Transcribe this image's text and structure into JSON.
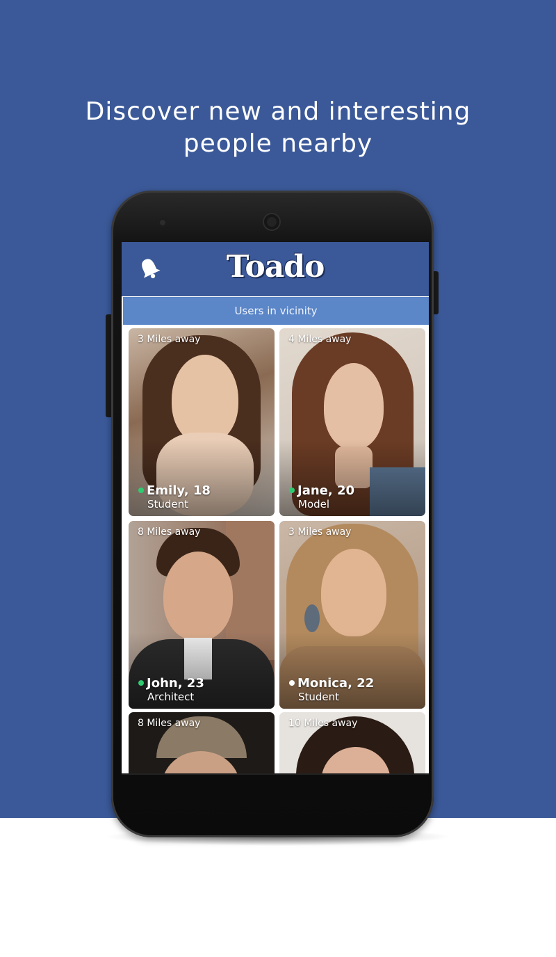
{
  "headline": {
    "line1": "Discover new and interesting",
    "line2": "people nearby"
  },
  "app": {
    "brand": "Toado",
    "subtitle": "Users in vicinity",
    "bell_icon": "bell-icon"
  },
  "colors": {
    "background_blue": "#3b5998",
    "appbar": "#3b5998",
    "subbar": "#5b86c8",
    "online_dot": "#2ecc71",
    "offline_dot": "#ffffff"
  },
  "cards": [
    {
      "distance": "3 Miles away",
      "name": "Emily, 18",
      "job": "Student",
      "status": "online"
    },
    {
      "distance": "4 Miles away",
      "name": "Jane,  20",
      "job": "Model",
      "status": "online"
    },
    {
      "distance": "8 Miles away",
      "name": "John,  23",
      "job": "Architect",
      "status": "online"
    },
    {
      "distance": "3 Miles away",
      "name": "Monica, 22",
      "job": "Student",
      "status": "offline"
    },
    {
      "distance": "8 Miles away",
      "name": "",
      "job": "",
      "status": ""
    },
    {
      "distance": "10 Miles away",
      "name": "",
      "job": "",
      "status": ""
    }
  ]
}
